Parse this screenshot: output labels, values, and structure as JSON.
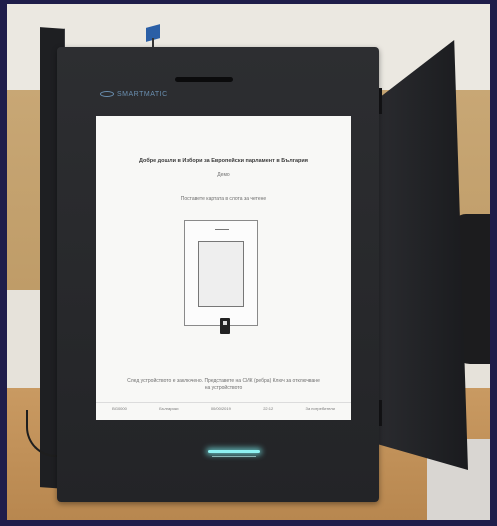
{
  "brand": {
    "name": "SMARTMATIC"
  },
  "screen": {
    "title": "Добре дошли в Избори за Европейски парламент в България",
    "subtitle": "Демо",
    "instruction": "Поставете картата в слота за четене",
    "footer": "След устройството е заключено. Представете на СИК (ребра) Ключ за отключване на устройството",
    "status": [
      "BG0000",
      "Български",
      "00/00/2019",
      "22:12",
      "За потребители"
    ]
  }
}
